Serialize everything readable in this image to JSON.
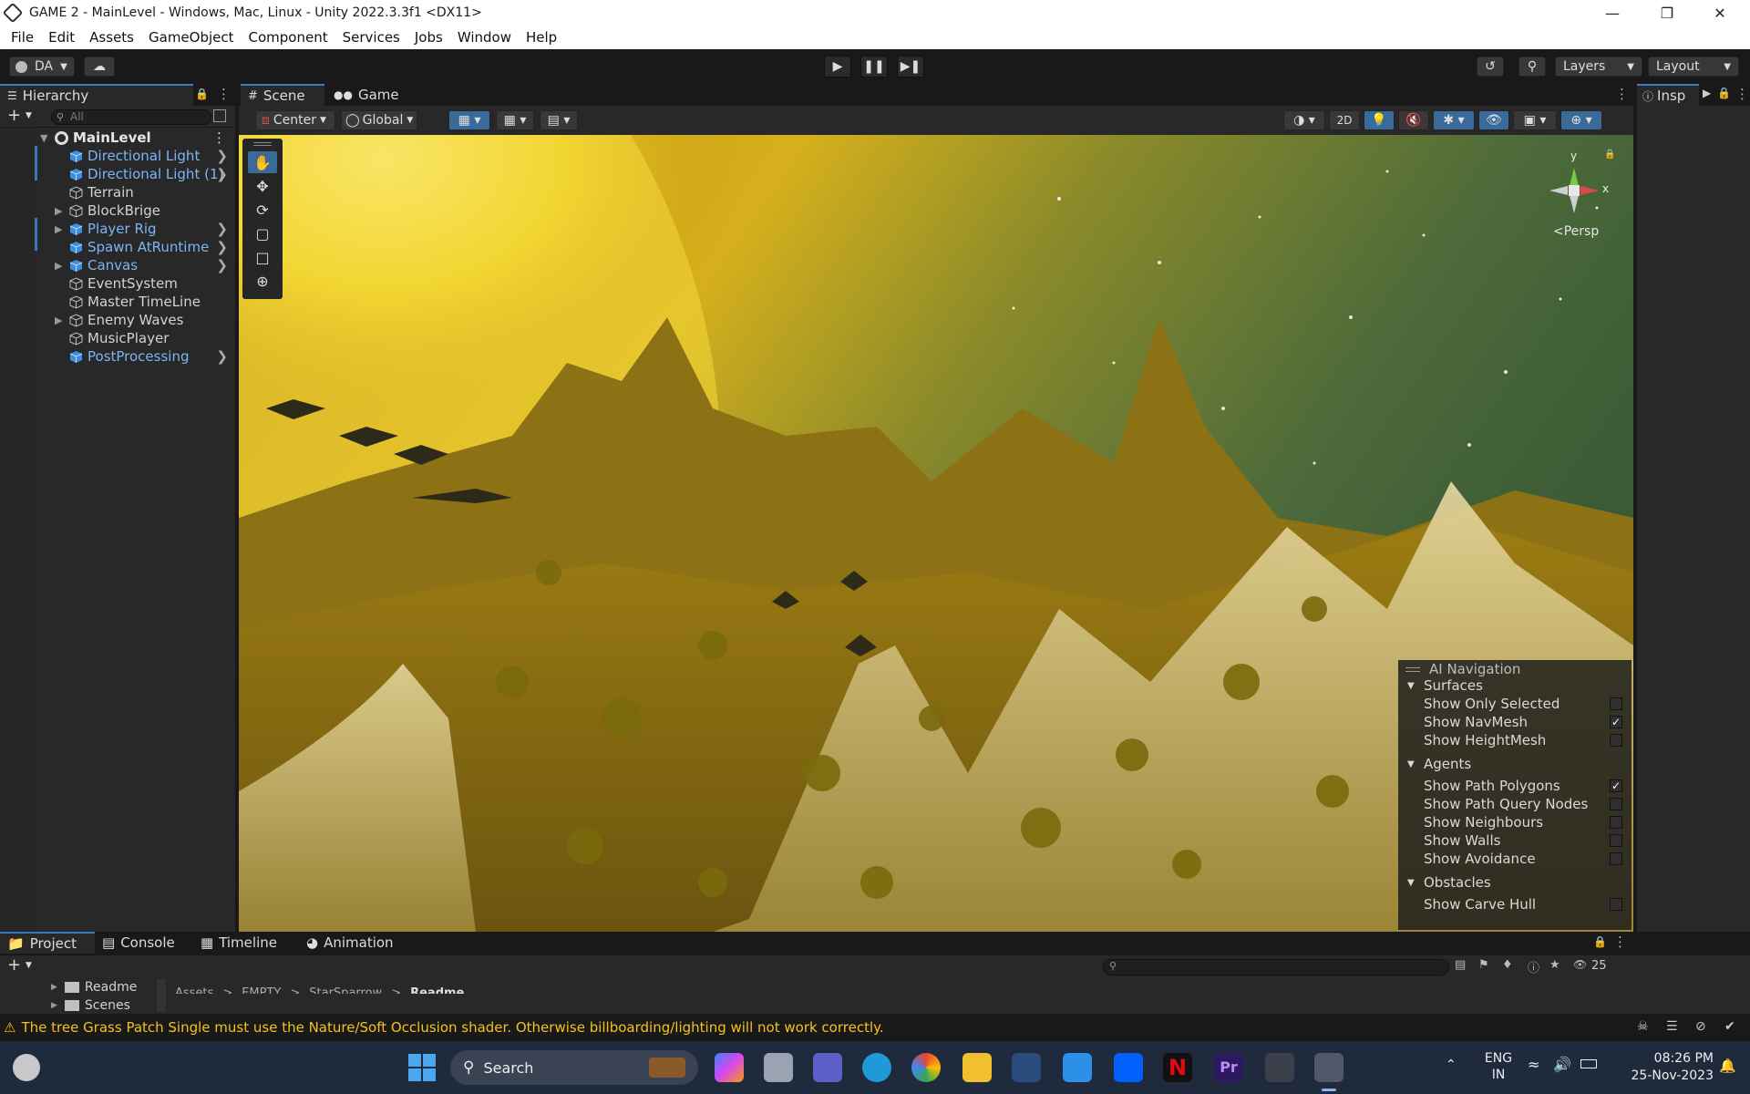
{
  "window": {
    "title": "GAME 2 - MainLevel - Windows, Mac, Linux - Unity 2022.3.3f1 <DX11>"
  },
  "menu": [
    "File",
    "Edit",
    "Assets",
    "GameObject",
    "Component",
    "Services",
    "Jobs",
    "Window",
    "Help"
  ],
  "toolbar": {
    "account": "DA",
    "layers": "Layers",
    "layout": "Layout"
  },
  "hierarchy": {
    "tab": "Hierarchy",
    "search_placeholder": "All",
    "scene": "MainLevel",
    "items": [
      {
        "name": "Directional Light",
        "prefab": true,
        "expandable": false
      },
      {
        "name": "Directional Light (1)",
        "prefab": true,
        "expandable": false
      },
      {
        "name": "Terrain",
        "prefab": false,
        "expandable": false
      },
      {
        "name": "BlockBrige",
        "prefab": false,
        "expandable": true
      },
      {
        "name": "Player Rig",
        "prefab": true,
        "expandable": true
      },
      {
        "name": "Spawn AtRuntime",
        "prefab": true,
        "expandable": false
      },
      {
        "name": "Canvas",
        "prefab": true,
        "expandable": true
      },
      {
        "name": "EventSystem",
        "prefab": false,
        "expandable": false
      },
      {
        "name": "Master TimeLine",
        "prefab": false,
        "expandable": false
      },
      {
        "name": "Enemy Waves",
        "prefab": false,
        "expandable": true
      },
      {
        "name": "MusicPlayer",
        "prefab": false,
        "expandable": false
      },
      {
        "name": "PostProcessing",
        "prefab": true,
        "expandable": false
      }
    ]
  },
  "scene_tabs": {
    "scene": "Scene",
    "game": "Game"
  },
  "scene_toolbar": {
    "pivot": "Center",
    "space": "Global",
    "mode_2d": "2D"
  },
  "gizmo": {
    "y": "y",
    "x": "x",
    "projection": "<Persp"
  },
  "inspector": {
    "tab": "Insp"
  },
  "ai_navigation": {
    "title": "AI Navigation",
    "sections": [
      {
        "label": "Surfaces",
        "items": [
          {
            "label": "Show Only Selected",
            "checked": false
          },
          {
            "label": "Show NavMesh",
            "checked": true
          },
          {
            "label": "Show HeightMesh",
            "checked": false
          }
        ]
      },
      {
        "label": "Agents",
        "items": [
          {
            "label": "Show Path Polygons",
            "checked": true
          },
          {
            "label": "Show Path Query Nodes",
            "checked": false
          },
          {
            "label": "Show Neighbours",
            "checked": false
          },
          {
            "label": "Show Walls",
            "checked": false
          },
          {
            "label": "Show Avoidance",
            "checked": false
          }
        ]
      },
      {
        "label": "Obstacles",
        "items": [
          {
            "label": "Show Carve Hull",
            "checked": false
          }
        ]
      }
    ]
  },
  "bottom_tabs": [
    "Project",
    "Console",
    "Timeline",
    "Animation"
  ],
  "project": {
    "folders": [
      "Readme",
      "Scenes"
    ],
    "breadcrumb": [
      "Assets",
      "EMPTY",
      "StarSparrow",
      "Readme"
    ],
    "hidden_count": "25"
  },
  "status": {
    "message": "The tree Grass Patch Single must use the Nature/Soft Occlusion shader. Otherwise billboarding/lighting will not work correctly."
  },
  "taskbar": {
    "search": "Search",
    "lang_top": "ENG",
    "lang_bottom": "IN",
    "time": "08:26 PM",
    "date": "25-Nov-2023"
  },
  "colors": {
    "editor_dark": "#191919",
    "panel": "#282828",
    "prefab_blue": "#7db4f5",
    "accent_blue": "#3a79bb",
    "warning_yellow": "#f4c21b"
  }
}
